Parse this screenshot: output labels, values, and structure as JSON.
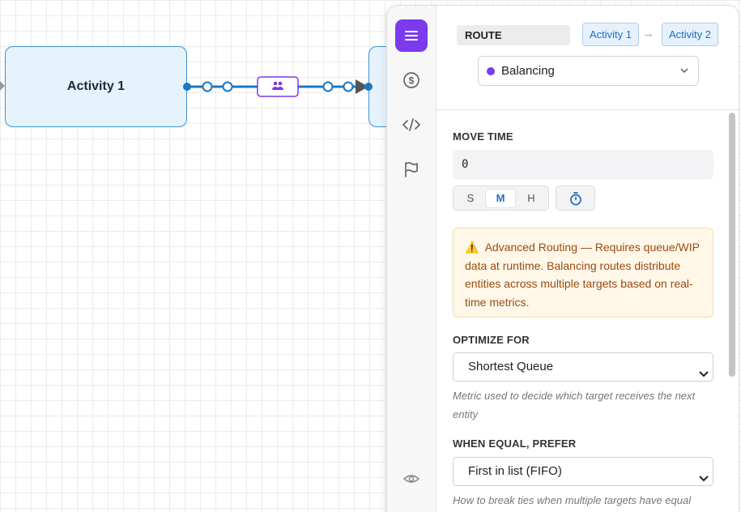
{
  "canvas": {
    "node_1_label": "Activity 1",
    "edge_badge_icon": "people-icon"
  },
  "panel": {
    "rail": {
      "items": [
        {
          "icon": "menu-icon",
          "active": true
        },
        {
          "icon": "dollar-icon",
          "active": false
        },
        {
          "icon": "code-icon",
          "active": false
        },
        {
          "icon": "flag-icon",
          "active": false
        },
        {
          "icon": "eye-icon",
          "active": false
        }
      ]
    },
    "header": {
      "route_label": "ROUTE",
      "from_chip": "Activity 1",
      "arrow": "→",
      "to_chip": "Activity 2",
      "route_type": "Balancing",
      "route_type_color": "#7c3aed"
    },
    "move_time": {
      "label": "MOVE TIME",
      "value": "0",
      "units": [
        "S",
        "M",
        "H"
      ],
      "selected_unit": "M"
    },
    "warning": {
      "icon": "⚠️",
      "text": "Advanced Routing — Requires queue/WIP data at runtime. Balancing routes distribute entities across multiple targets based on real-time metrics."
    },
    "optimize_for": {
      "label": "OPTIMIZE FOR",
      "selected": "Shortest Queue",
      "hint": "Metric used to decide which target receives the next entity"
    },
    "when_equal": {
      "label": "WHEN EQUAL, PREFER",
      "selected": "First in list (FIFO)",
      "hint": "How to break ties when multiple targets have equal scores"
    }
  },
  "colors": {
    "accent_purple": "#7c3aed",
    "link_blue": "#1f6fc0",
    "edge_blue": "#1a78c2",
    "warning_text": "#9a4b12",
    "warning_bg": "#fff7e8"
  }
}
